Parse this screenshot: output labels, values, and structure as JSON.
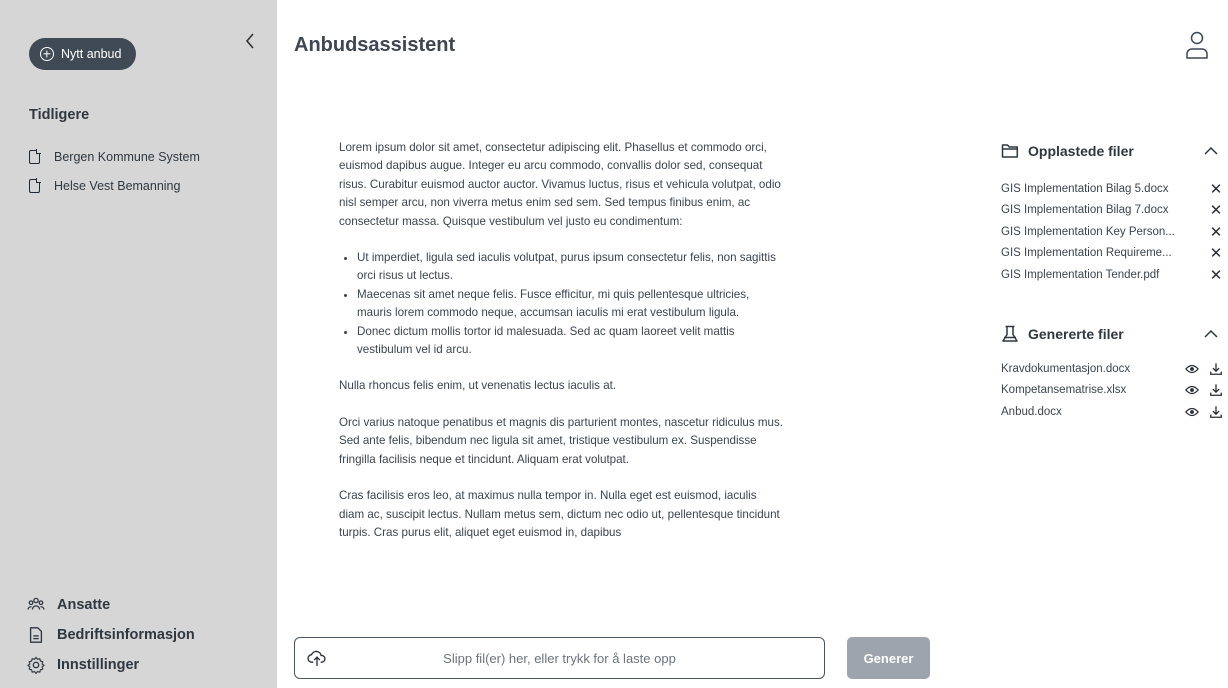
{
  "sidebar": {
    "new_button": "Nytt anbud",
    "collapse_icon": "chevron-left-icon",
    "history_title": "Tidligere",
    "history": [
      {
        "label": "Bergen Kommune System"
      },
      {
        "label": "Helse Vest Bemanning"
      }
    ],
    "nav": [
      {
        "label": "Ansatte",
        "icon": "people-icon"
      },
      {
        "label": "Bedriftsinformasjon",
        "icon": "document-icon"
      },
      {
        "label": "Innstillinger",
        "icon": "gear-icon"
      }
    ]
  },
  "header": {
    "title": "Anbudsassistent",
    "user_icon": "user-icon"
  },
  "content": {
    "p1": "Lorem ipsum dolor sit amet, consectetur adipiscing elit. Phasellus et commodo orci, euismod dapibus augue. Integer eu arcu commodo, convallis dolor sed, consequat risus. Curabitur euismod auctor auctor. Vivamus luctus, risus et vehicula volutpat, odio nisl semper arcu, non viverra metus enim sed sem. Sed tempus finibus enim, ac consectetur massa. Quisque vestibulum vel justo eu condimentum:",
    "bullets": [
      "Ut imperdiet, ligula sed iaculis volutpat, purus ipsum consectetur felis, non sagittis orci risus ut lectus.",
      "Maecenas sit amet neque felis. Fusce efficitur, mi quis pellentesque ultricies, mauris lorem commodo neque, accumsan iaculis mi erat vestibulum ligula.",
      "Donec dictum mollis tortor id malesuada. Sed ac quam laoreet velit mattis vestibulum vel id arcu."
    ],
    "p2": "Nulla rhoncus felis enim, ut venenatis lectus iaculis at.",
    "p3": "Orci varius natoque penatibus et magnis dis parturient montes, nascetur ridiculus mus. Sed ante felis, bibendum nec ligula sit amet, tristique vestibulum ex. Suspendisse fringilla facilisis neque et tincidunt. Aliquam erat volutpat.",
    "p4": "Cras facilisis eros leo, at maximus nulla tempor in. Nulla eget est euismod, iaculis diam ac, suscipit lectus. Nullam metus sem, dictum nec odio ut, pellentesque tincidunt turpis. Cras purus elit, aliquet eget euismod in, dapibus"
  },
  "upload": {
    "placeholder": "Slipp fil(er) her, eller trykk for å laste opp",
    "icon": "cloud-upload-icon"
  },
  "generate_button": "Generer",
  "uploaded": {
    "title": "Opplastede filer",
    "icon": "folder-icon",
    "files": [
      {
        "name": "GIS Implementation Bilag 5.docx"
      },
      {
        "name": "GIS Implementation Bilag 7.docx"
      },
      {
        "name": "GIS Implementation Key Person..."
      },
      {
        "name": "GIS Implementation Requireme..."
      },
      {
        "name": "GIS Implementation Tender.pdf"
      }
    ],
    "remove_symbol": "✕"
  },
  "generated": {
    "title": "Genererte filer",
    "icon": "flask-icon",
    "files": [
      {
        "name": "Kravdokumentasjon.docx"
      },
      {
        "name": "Kompetansematrise.xlsx"
      },
      {
        "name": "Anbud.docx"
      }
    ]
  }
}
